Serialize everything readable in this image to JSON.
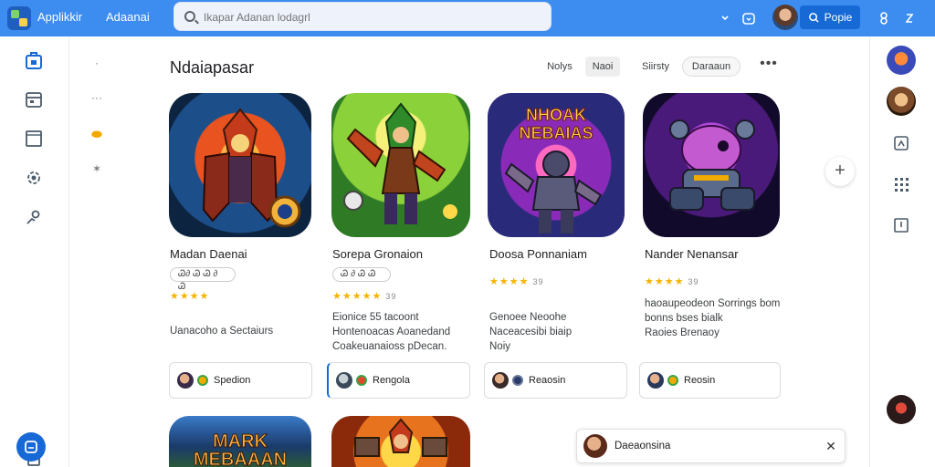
{
  "app": {
    "title": "Applikkir",
    "section": "Adaanai"
  },
  "search": {
    "placeholder": "Ikapar Adanan lodagrl"
  },
  "topbar": {
    "primary_button_label": "Popie"
  },
  "main": {
    "heading": "Ndaiapasar",
    "filters": [
      {
        "label": "Nolys"
      },
      {
        "label": "Naoi"
      },
      {
        "label": "Siirsty"
      },
      {
        "label": "Daraaun"
      }
    ],
    "apps": [
      {
        "title": "Madan Daenai",
        "pill": "Ꮚ∂ Ꮚ Ꮚ ∂ Ꮚ",
        "stars": "★★★★",
        "rating_count": "",
        "desc": [
          "Uanacoho a Sectaiurs"
        ],
        "chip_label": "Spedion"
      },
      {
        "title": "Sorepa Gronaion",
        "pill": "Ꮚ ∂ Ꮚ Ꮚ",
        "stars": "★★★★★",
        "rating_count": "39",
        "desc": [
          "Eionice 55 tacoont",
          "Hontenoacas Aoanedand",
          "Coakeuanaioss pDecan."
        ],
        "chip_label": "Rengola"
      },
      {
        "title": "Doosa Ponnaniam",
        "pill": "",
        "stars": "★★★★",
        "rating_count": "39",
        "desc": [
          "Genoee Neoohe",
          "Naceacesibi biaip",
          "Noiy"
        ],
        "chip_label": "Reaosin"
      },
      {
        "title": "Nander Nenansar",
        "pill": "",
        "stars": "★★★★",
        "rating_count": "39",
        "desc": [
          "haoaupeodeon Sorrings bom",
          "bonns bses bialk",
          "Raoies Brenaoy"
        ],
        "chip_label": "Reosin"
      }
    ],
    "bottom_card_text": [
      "MARK",
      "MEBAAAN"
    ],
    "top_card_text": [
      "NHOAK",
      "NEBAIAS"
    ]
  },
  "toast": {
    "text": "Daeaonsina"
  },
  "colors": {
    "topbar": "#3d8cf0",
    "primary_button": "#1769d6",
    "star": "#f5b400"
  }
}
